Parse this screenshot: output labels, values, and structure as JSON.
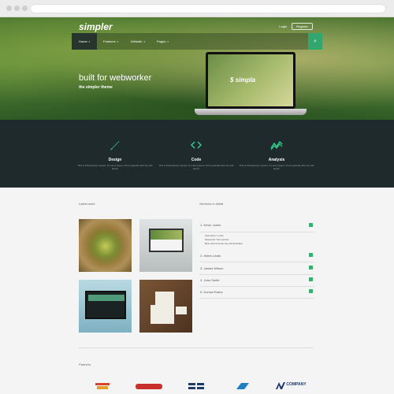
{
  "brand": {
    "logo": "simpler",
    "laptop_logo": "simpla"
  },
  "header": {
    "login": "Login",
    "register": "Register"
  },
  "nav": {
    "items": [
      {
        "label": "Home"
      },
      {
        "label": "Features"
      },
      {
        "label": "Website"
      },
      {
        "label": "Pages"
      }
    ]
  },
  "hero": {
    "title": "built for webworker",
    "subtitle": "the simpler theme"
  },
  "features": [
    {
      "title": "Design",
      "desc": "This is Photoshop's version of Lorem Ipsum. Proin gravida nibh vel velit auctor"
    },
    {
      "title": "Code",
      "desc": "This is Photoshop's version of Lorem Ipsum. Proin gravida nibh vel velit auctor"
    },
    {
      "title": "Analysis",
      "desc": "This is Photoshop's version of Lorem Ipsum. Proin gravida nibh vel velit auctor"
    }
  ],
  "latest_work": {
    "title": "Latest work"
  },
  "services": {
    "title": "Services in detail",
    "items": [
      {
        "label": "1. Kevin Jones",
        "expanded": true,
        "lines": [
          "Username: Lorem",
          "Password: Not number",
          "Best start and use any administrator"
        ]
      },
      {
        "label": "2. Helen Lewis"
      },
      {
        "label": "3. James Wilson"
      },
      {
        "label": "4. John Smith"
      },
      {
        "label": "5. Donna Evans"
      }
    ]
  },
  "partners": {
    "title": "Partners",
    "logos": [
      "",
      "",
      "",
      "",
      "COMPANY"
    ]
  }
}
